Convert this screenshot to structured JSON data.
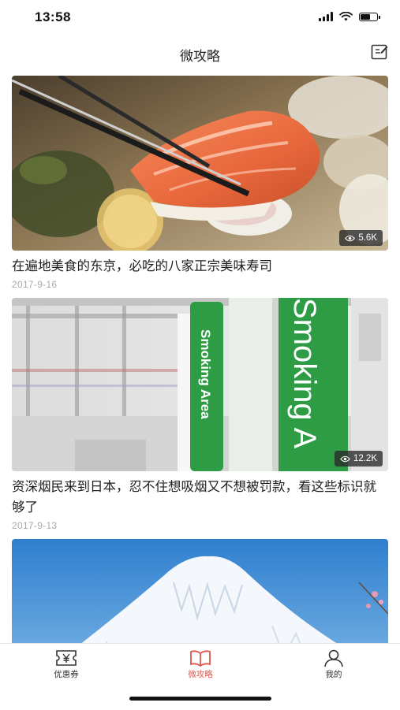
{
  "status_bar": {
    "time": "13:58",
    "battery_level": 0.65
  },
  "nav": {
    "title": "微攻略",
    "edit_icon": "edit-icon"
  },
  "articles": [
    {
      "title": "在遍地美食的东京，必吃的八家正宗美味寿司",
      "date": "2017-9-16",
      "views": "5.6K"
    },
    {
      "title": "资深烟民来到日本，忍不住想吸烟又不想被罚款，看这些标识就够了",
      "date": "2017-9-13",
      "views": "12.2K",
      "sign_text": "Smoking Area",
      "sign_text_big": "Smoking A"
    },
    {
      "title": "",
      "date": "",
      "views": ""
    }
  ],
  "tabs": [
    {
      "label": "优惠券",
      "icon": "coupon-icon"
    },
    {
      "label": "微攻略",
      "icon": "book-icon",
      "active": true
    },
    {
      "label": "我的",
      "icon": "user-icon"
    }
  ],
  "colors": {
    "accent": "#e2564e",
    "sign_green": "#2e9b45"
  }
}
